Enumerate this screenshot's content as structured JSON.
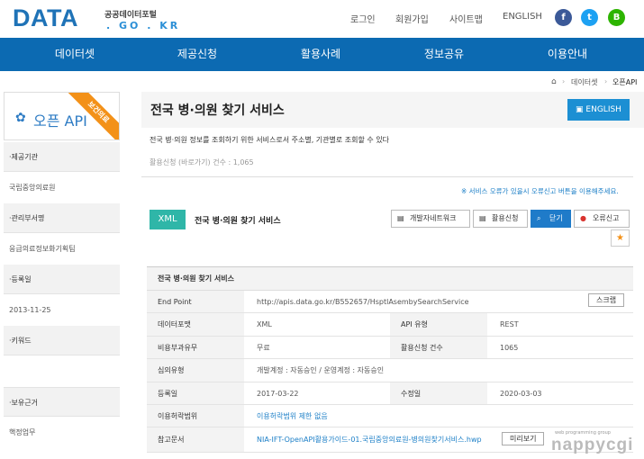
{
  "header": {
    "logo_main": "DATA",
    "logo_sub1": "공공데이터포털",
    "logo_sub2": ". GO . KR",
    "util_links": [
      "로그인",
      "회원가입",
      "사이트맵",
      "ENGLISH"
    ],
    "sns": [
      {
        "name": "facebook-icon",
        "glyph": "f",
        "color": "#3b5998"
      },
      {
        "name": "twitter-icon",
        "glyph": "t",
        "color": "#1da1f2"
      },
      {
        "name": "blog-icon",
        "glyph": "B",
        "color": "#2db400"
      }
    ]
  },
  "gnb": [
    "데이터셋",
    "제공신청",
    "활용사례",
    "정보공유",
    "이용안내"
  ],
  "breadcrumb": {
    "home_icon": "⌂",
    "items": [
      "데이터셋",
      "오픈API"
    ]
  },
  "sidebar": {
    "title": "오픈 API",
    "ribbon": "보건의료",
    "fields": [
      {
        "label": "·제공기관",
        "value": "국립중앙의료원"
      },
      {
        "label": "·관리부서명",
        "value": "응급의료정보화기획팀"
      },
      {
        "label": "·등록일",
        "value": "2013-11-25"
      },
      {
        "label": "·키워드",
        "value": ""
      },
      {
        "label": "·보유근거",
        "value": "핵정업무"
      }
    ]
  },
  "main": {
    "title": "전국 병·의원 찾기 서비스",
    "english_button": "ENGLISH",
    "description": "전국 병·의원 정보를 조회하기 위한 서비스로서 주소별, 기관별로 조회할 수 있다",
    "count_text": "활용신청 (바로가기) 건수 : 1,065",
    "notice": "※ 서비스 오류가 있을시 오류신고 버튼을 이용해주세요.",
    "format_tag": "XML",
    "service_name": "전국 병·의원 찾기 서비스",
    "actions": [
      {
        "name": "dev-network-button",
        "icon": "▤",
        "label": "개발자네트워크"
      },
      {
        "name": "apply-button",
        "icon": "▤",
        "label": "활용신청"
      },
      {
        "name": "close-button",
        "icon": "⌕",
        "label": "닫기"
      },
      {
        "name": "report-error-button",
        "icon": "●",
        "label": "오류신고"
      }
    ],
    "star": "★"
  },
  "table": {
    "title": "전국 병·의원 찾기 서비스",
    "endpoint_label": "End Point",
    "endpoint": "http://apis.data.go.kr/B552657/HsptlAsembySearchService",
    "scrap_button": "스크랩",
    "format_label": "데이터포맷",
    "format": "XML",
    "api_type_label": "API 유형",
    "api_type": "REST",
    "fee_label": "비용부과유무",
    "fee": "무료",
    "apply_count_label": "활용신청 건수",
    "apply_count": "1065",
    "review_label": "심의유형",
    "review": "개발계정 : 자동승인 / 운영계정 : 자동승인",
    "reg_label": "등록일",
    "reg_date": "2017-03-22",
    "mod_label": "수정일",
    "mod_date": "2020-03-03",
    "license_label": "이용허락범위",
    "license": "이용허락범위 제한 없음",
    "ref_label": "참고문서",
    "ref_doc": "NIA-IFT-OpenAPI활용가이드-01.국립중앙의료원-병의원찾기서비스.hwp",
    "preview_button": "미리보기"
  },
  "watermark": {
    "small": "web programming group",
    "big": "nappycgi"
  }
}
